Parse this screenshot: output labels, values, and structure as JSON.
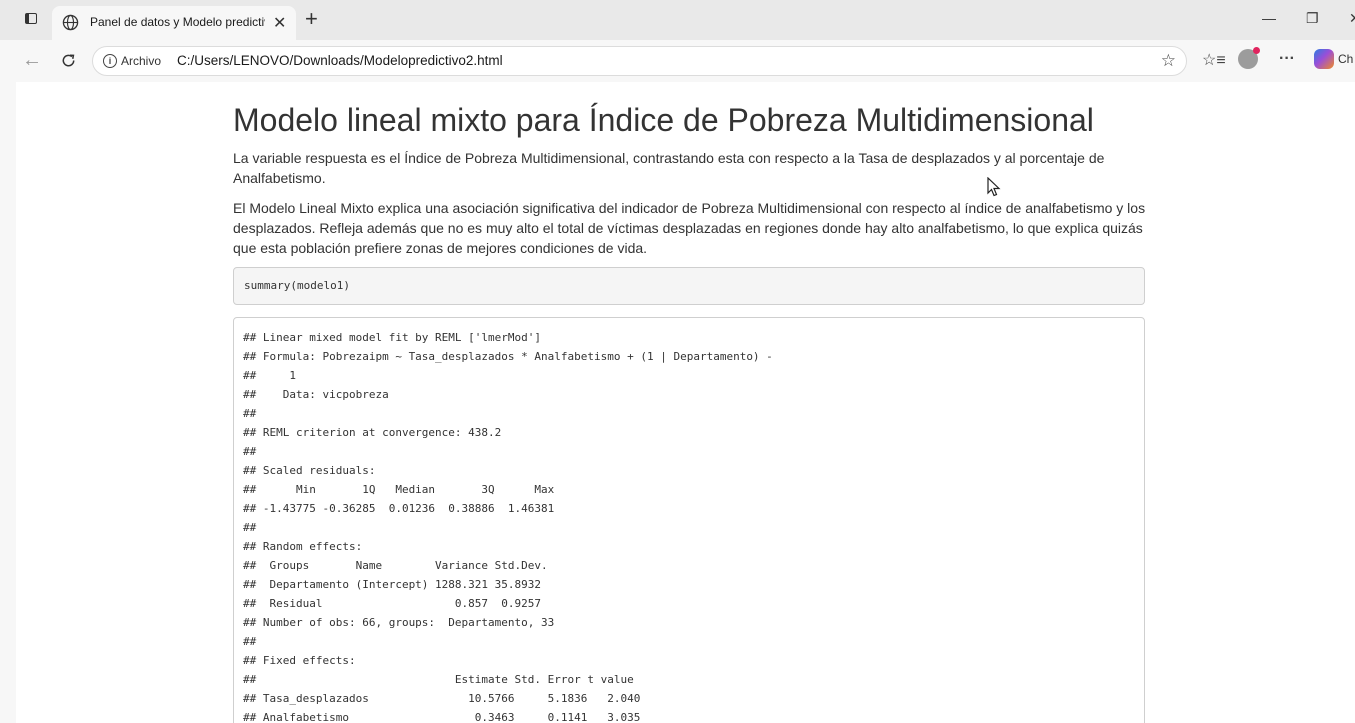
{
  "browser": {
    "tab_title": "Panel de datos y Modelo predictivo",
    "new_tab": "+",
    "protocol_label": "Archivo",
    "url": "C:/Users/LENOVO/Downloads/Modelopredictivo2.html",
    "more_label": "···",
    "copilot_label": "Ch"
  },
  "page": {
    "title": "Modelo lineal mixto para Índice de Pobreza Multidimensional",
    "paragraph1": "La variable respuesta es el Índice de Pobreza Multidimensional, contrastando esta con respecto a la Tasa de desplazados y al porcentaje de Analfabetismo.",
    "paragraph2": "El Modelo Lineal Mixto explica una asociación significativa del indicador de Pobreza Multidimensional con respecto al índice de analfabetismo y los desplazados. Refleja además que no es muy alto el total de víctimas desplazadas en regiones donde hay alto analfabetismo, lo que explica quizás que esta población prefiere zonas de mejores condiciones de vida.",
    "code": "summary(modelo1)",
    "output_lines": [
      "## Linear mixed model fit by REML ['lmerMod']",
      "## Formula: Pobrezaipm ~ Tasa_desplazados * Analfabetismo + (1 | Departamento) -",
      "##     1",
      "##    Data: vicpobreza",
      "##",
      "## REML criterion at convergence: 438.2",
      "##",
      "## Scaled residuals:",
      "##      Min       1Q   Median       3Q      Max",
      "## -1.43775 -0.36285  0.01236  0.38886  1.46381",
      "##",
      "## Random effects:",
      "##  Groups       Name        Variance Std.Dev.",
      "##  Departamento (Intercept) 1288.321 35.8932",
      "##  Residual                    0.857  0.9257",
      "## Number of obs: 66, groups:  Departamento, 33",
      "##",
      "## Fixed effects:",
      "##                              Estimate Std. Error t value",
      "## Tasa_desplazados               10.5766     5.1836   2.040",
      "## Analfabetismo                   0.3463     0.1141   3.035"
    ]
  }
}
